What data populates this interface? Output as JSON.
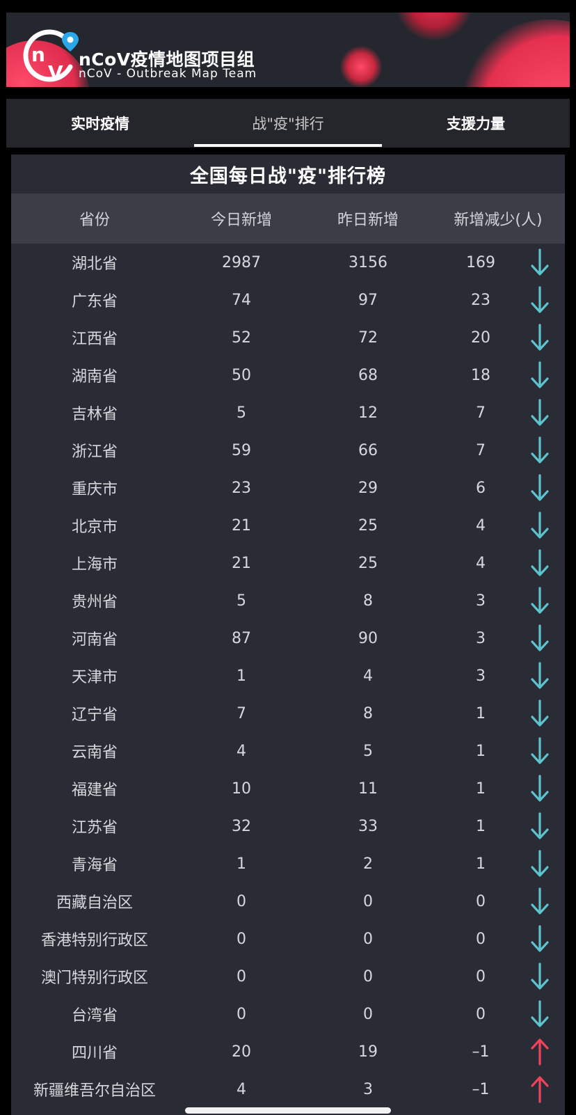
{
  "brand": {
    "title": "nCoV疫情地图项目组",
    "subtitle": "nCoV - Outbreak Map Team",
    "logo_text_n": "n",
    "logo_text_v": "V",
    "accent": "#e8304f",
    "pin_color": "#2aa7e8"
  },
  "tabs": [
    {
      "label": "实时疫情",
      "active": false
    },
    {
      "label": "战\"疫\"排行",
      "active": true
    },
    {
      "label": "支援力量",
      "active": false
    }
  ],
  "board": {
    "title": "全国每日战\"疫\"排行榜",
    "headers": {
      "province": "省份",
      "today": "今日新增",
      "yesterday": "昨日新增",
      "decrease": "新增减少(人)"
    },
    "down_color": "#5ec3cc",
    "up_color": "#f0425d",
    "rows": [
      {
        "province": "湖北省",
        "today": "2987",
        "yesterday": "3156",
        "decrease": "169",
        "trend": "down"
      },
      {
        "province": "广东省",
        "today": "74",
        "yesterday": "97",
        "decrease": "23",
        "trend": "down"
      },
      {
        "province": "江西省",
        "today": "52",
        "yesterday": "72",
        "decrease": "20",
        "trend": "down"
      },
      {
        "province": "湖南省",
        "today": "50",
        "yesterday": "68",
        "decrease": "18",
        "trend": "down"
      },
      {
        "province": "吉林省",
        "today": "5",
        "yesterday": "12",
        "decrease": "7",
        "trend": "down"
      },
      {
        "province": "浙江省",
        "today": "59",
        "yesterday": "66",
        "decrease": "7",
        "trend": "down"
      },
      {
        "province": "重庆市",
        "today": "23",
        "yesterday": "29",
        "decrease": "6",
        "trend": "down"
      },
      {
        "province": "北京市",
        "today": "21",
        "yesterday": "25",
        "decrease": "4",
        "trend": "down"
      },
      {
        "province": "上海市",
        "today": "21",
        "yesterday": "25",
        "decrease": "4",
        "trend": "down"
      },
      {
        "province": "贵州省",
        "today": "5",
        "yesterday": "8",
        "decrease": "3",
        "trend": "down"
      },
      {
        "province": "河南省",
        "today": "87",
        "yesterday": "90",
        "decrease": "3",
        "trend": "down"
      },
      {
        "province": "天津市",
        "today": "1",
        "yesterday": "4",
        "decrease": "3",
        "trend": "down"
      },
      {
        "province": "辽宁省",
        "today": "7",
        "yesterday": "8",
        "decrease": "1",
        "trend": "down"
      },
      {
        "province": "云南省",
        "today": "4",
        "yesterday": "5",
        "decrease": "1",
        "trend": "down"
      },
      {
        "province": "福建省",
        "today": "10",
        "yesterday": "11",
        "decrease": "1",
        "trend": "down"
      },
      {
        "province": "江苏省",
        "today": "32",
        "yesterday": "33",
        "decrease": "1",
        "trend": "down"
      },
      {
        "province": "青海省",
        "today": "1",
        "yesterday": "2",
        "decrease": "1",
        "trend": "down"
      },
      {
        "province": "西藏自治区",
        "today": "0",
        "yesterday": "0",
        "decrease": "0",
        "trend": "down"
      },
      {
        "province": "香港特别行政区",
        "today": "0",
        "yesterday": "0",
        "decrease": "0",
        "trend": "down"
      },
      {
        "province": "澳门特别行政区",
        "today": "0",
        "yesterday": "0",
        "decrease": "0",
        "trend": "down"
      },
      {
        "province": "台湾省",
        "today": "0",
        "yesterday": "0",
        "decrease": "0",
        "trend": "down"
      },
      {
        "province": "四川省",
        "today": "20",
        "yesterday": "19",
        "decrease": "–1",
        "trend": "up"
      },
      {
        "province": "新疆维吾尔自治区",
        "today": "4",
        "yesterday": "3",
        "decrease": "–1",
        "trend": "up"
      }
    ]
  }
}
